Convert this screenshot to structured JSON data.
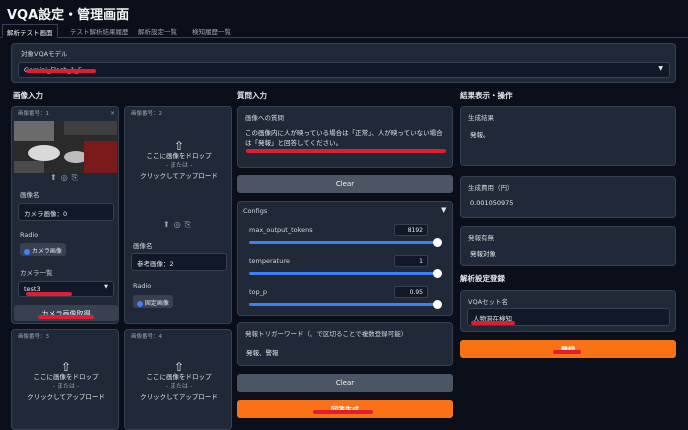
{
  "app": {
    "title": "VQA設定・管理画面"
  },
  "tabs": [
    "解析テスト画面",
    "テスト解析結果履歴",
    "解析設定一覧",
    "検知履歴一覧"
  ],
  "model": {
    "label": "対象VQAモデル",
    "value": "Gemini_Flash_1_5"
  },
  "image_input": {
    "heading": "画像入力",
    "slots": [
      {
        "tag": "画像番号：1",
        "name_label": "画像名",
        "name_value": "カメラ画像：0",
        "radio_label": "Radio",
        "radio_option": "カメラ画像",
        "camera_label": "カメラ一覧",
        "camera_value": "test3",
        "fetch_button": "カメラ画像取得"
      },
      {
        "tag": "画像番号：2",
        "drop_main": "ここに画像をドロップ",
        "drop_or": "- または -",
        "drop_click": "クリックしてアップロード",
        "name_label": "画像名",
        "name_value": "参考画像：2",
        "radio_label": "Radio",
        "radio_option": "固定画像"
      },
      {
        "tag": "画像番号：3",
        "drop_main": "ここに画像をドロップ",
        "drop_or": "- または -",
        "drop_click": "クリックしてアップロード"
      },
      {
        "tag": "画像番号：4",
        "drop_main": "ここに画像をドロップ",
        "drop_or": "- または -",
        "drop_click": "クリックしてアップロード"
      }
    ]
  },
  "question": {
    "heading": "質問入力",
    "label": "画像への質問",
    "text": "この画像内に人が映っている場合は「正常」、人が映っていない場合は「発報」と回答してください。",
    "clear": "Clear",
    "configs_label": "Configs",
    "params": [
      {
        "name": "max_output_tokens",
        "value": "8192",
        "fraction": 1.0
      },
      {
        "name": "temperature",
        "value": "1",
        "fraction": 1.0
      },
      {
        "name": "top_p",
        "value": "0.95",
        "fraction": 1.0
      }
    ],
    "trigger_label": "発報トリガーワード（、で区切ることで複数登録可能）",
    "trigger_value": "発報、警報",
    "clear2": "Clear",
    "run": "回答生成"
  },
  "results": {
    "heading": "結果表示・操作",
    "generated_label": "生成結果",
    "generated_value": "発報。",
    "cost_label": "生成費用（円）",
    "cost_value": "0.001050975",
    "alert_label": "発報有無",
    "alert_value": "発報対象",
    "register_heading": "解析設定登録",
    "set_label": "VQAセット名",
    "set_value": "人物滞在検知",
    "register_button": "登録"
  },
  "colors": {
    "accent": "#f97316",
    "slider": "#3b82f6",
    "bg": "#0b0f19",
    "panel": "#1f2937",
    "annotation": "#e11d2f"
  }
}
